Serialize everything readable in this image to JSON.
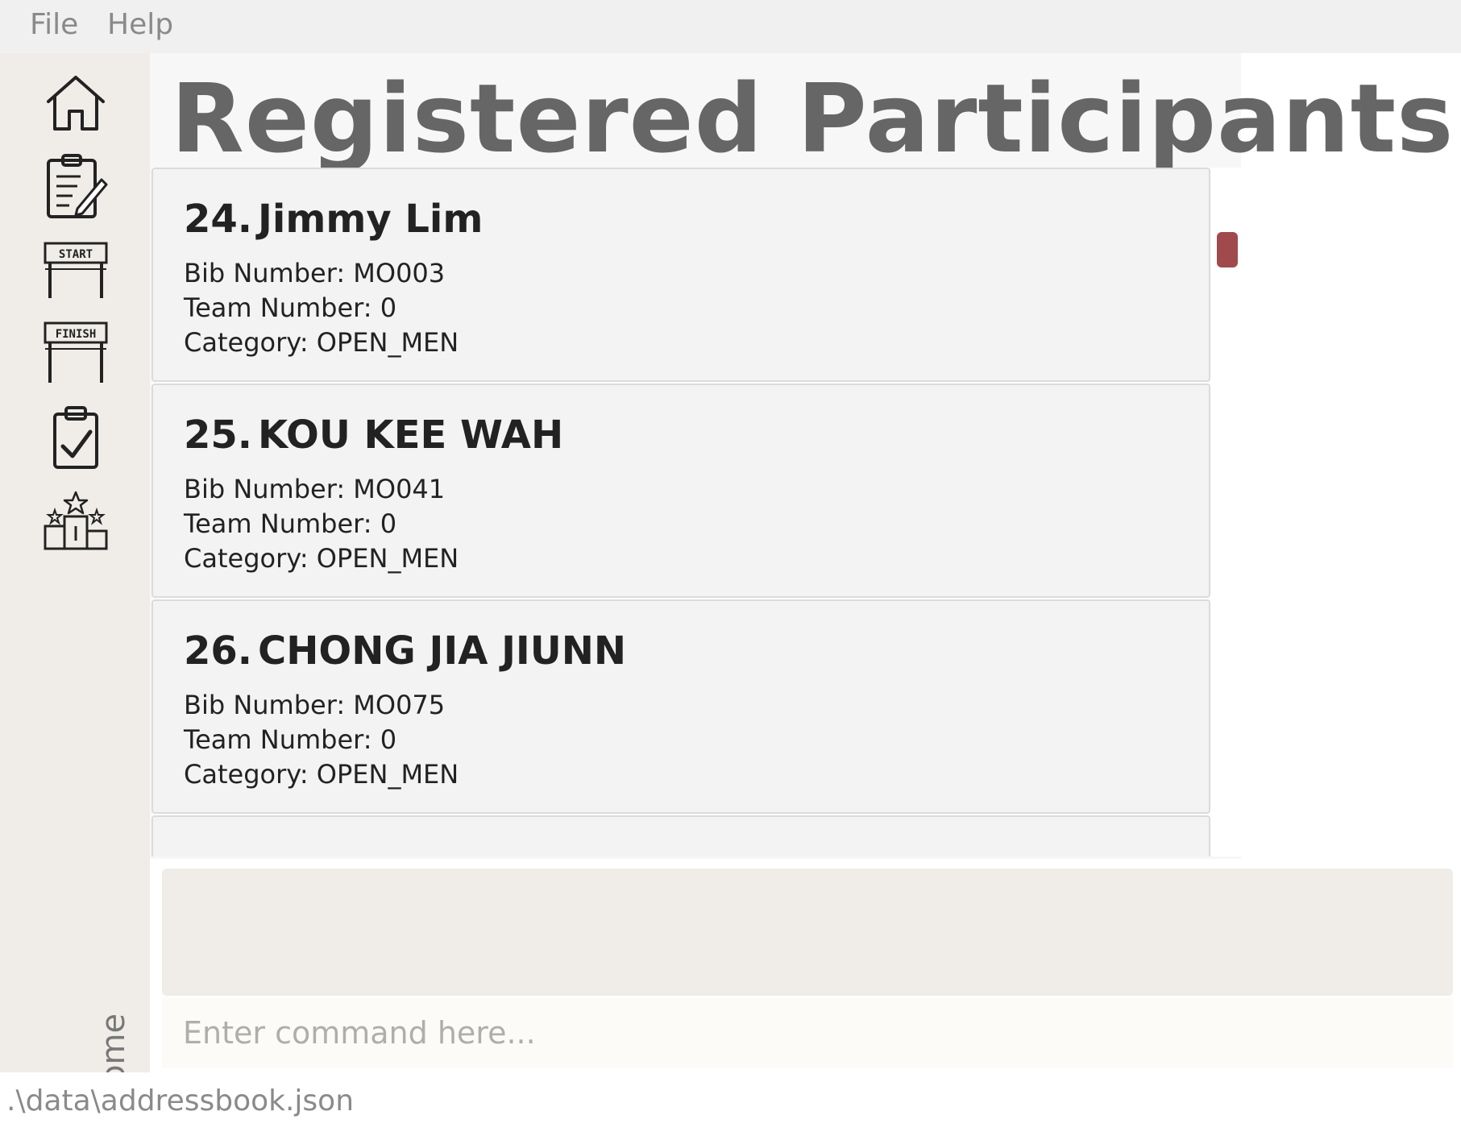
{
  "menu": [
    {
      "label": "File"
    },
    {
      "label": "Help"
    }
  ],
  "sidebar": {
    "items": [
      {
        "icon": "home-icon"
      },
      {
        "icon": "register-clipboard-icon"
      },
      {
        "icon": "start-banner-icon",
        "text": "START"
      },
      {
        "icon": "finish-banner-icon",
        "text": "FINISH"
      },
      {
        "icon": "checklist-clipboard-icon"
      },
      {
        "icon": "podium-icon"
      }
    ],
    "current_view": "Home"
  },
  "main": {
    "title": "Registered Participants",
    "participants": [
      {
        "index": "24.",
        "name": "Jimmy Lim",
        "bib": "Bib Number: MO003",
        "team": "Team Number: 0",
        "category": "Category: OPEN_MEN"
      },
      {
        "index": "25.",
        "name": "KOU KEE WAH",
        "bib": "Bib Number: MO041",
        "team": "Team Number: 0",
        "category": "Category: OPEN_MEN"
      },
      {
        "index": "26.",
        "name": "CHONG JIA JIUNN",
        "bib": "Bib Number: MO075",
        "team": "Team Number: 0",
        "category": "Category: OPEN_MEN"
      }
    ]
  },
  "command": {
    "result": "",
    "placeholder": "Enter command here..."
  },
  "status": {
    "path": ".\\data\\addressbook.json"
  },
  "colors": {
    "scroll_thumb": "#a04a4d",
    "title": "#666666",
    "sidebar_bg": "#f0ede8"
  }
}
